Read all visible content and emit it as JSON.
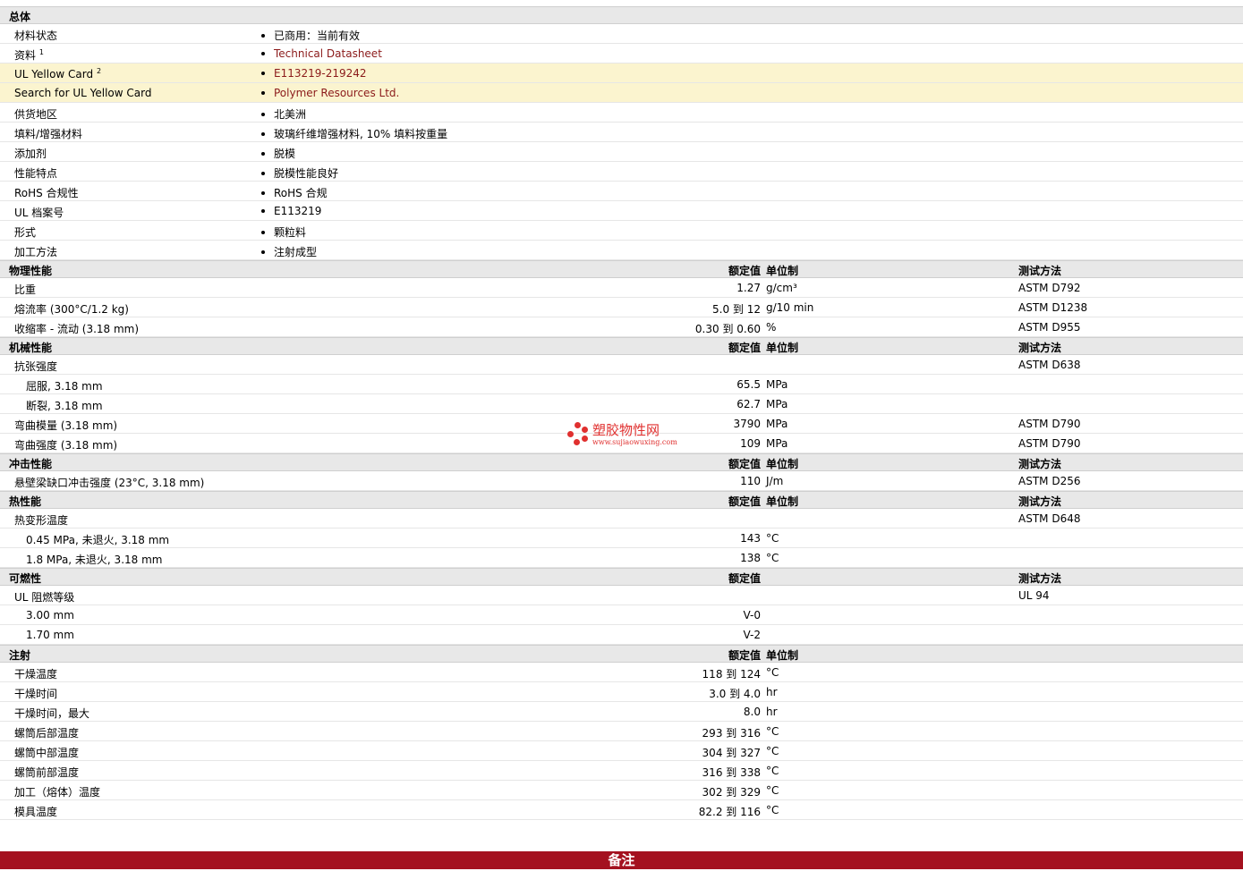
{
  "general": {
    "title": "总体",
    "rows": [
      {
        "label": "材料状态",
        "value": "已商用：当前有效"
      },
      {
        "label": "资料",
        "sup": "1",
        "value": "Technical Datasheet"
      },
      {
        "label": "UL Yellow Card",
        "sup": "2",
        "value": "E113219-219242"
      },
      {
        "label": "Search for UL Yellow Card",
        "value": "Polymer Resources Ltd."
      },
      {
        "label": "供货地区",
        "value": "北美洲"
      },
      {
        "label": "填料/增强材料",
        "value": "玻璃纤维增强材料, 10% 填料按重量"
      },
      {
        "label": "添加剂",
        "value": "脱模"
      },
      {
        "label": "性能特点",
        "value": "脱模性能良好"
      },
      {
        "label": "RoHS 合规性",
        "value": "RoHS 合规"
      },
      {
        "label": "UL 档案号",
        "value": "E113219"
      },
      {
        "label": "形式",
        "value": "颗粒料"
      },
      {
        "label": "加工方法",
        "value": "注射成型"
      }
    ]
  },
  "col_headers": {
    "nominal": "额定值",
    "unit": "单位制",
    "method": "测试方法"
  },
  "physical": {
    "title": "物理性能",
    "rows": [
      {
        "label": "比重",
        "value": "1.27",
        "unit": "g/cm³",
        "method": "ASTM D792"
      },
      {
        "label": "熔流率  (300°C/1.2 kg)",
        "value": "5.0 到  12",
        "unit": "g/10 min",
        "method": "ASTM D1238"
      },
      {
        "label": "收缩率  - 流动  (3.18 mm)",
        "value": "0.30 到  0.60",
        "unit": "%",
        "method": "ASTM D955"
      }
    ]
  },
  "mechanical": {
    "title": "机械性能",
    "rows": [
      {
        "label": "抗张强度",
        "value": "",
        "unit": "",
        "method": "ASTM D638"
      },
      {
        "label": "屈服, 3.18 mm",
        "value": "65.5",
        "unit": "MPa",
        "method": ""
      },
      {
        "label": "断裂, 3.18 mm",
        "value": "62.7",
        "unit": "MPa",
        "method": ""
      },
      {
        "label": "弯曲模量  (3.18 mm)",
        "value": "3790",
        "unit": "MPa",
        "method": "ASTM D790"
      },
      {
        "label": "弯曲强度  (3.18 mm)",
        "value": "109",
        "unit": "MPa",
        "method": "ASTM D790"
      }
    ]
  },
  "impact": {
    "title": "冲击性能",
    "rows": [
      {
        "label": "悬壁梁缺口冲击强度  (23°C, 3.18 mm)",
        "value": "110",
        "unit": "J/m",
        "method": "ASTM D256"
      }
    ]
  },
  "thermal": {
    "title": "热性能",
    "rows": [
      {
        "label": "热变形温度",
        "value": "",
        "unit": "",
        "method": "ASTM D648"
      },
      {
        "label": "0.45 MPa, 未退火, 3.18 mm",
        "value": "143",
        "unit": "°C",
        "method": ""
      },
      {
        "label": "1.8 MPa, 未退火, 3.18 mm",
        "value": "138",
        "unit": "°C",
        "method": ""
      }
    ]
  },
  "flammability": {
    "title": "可燃性",
    "rows": [
      {
        "label": "UL 阻燃等级",
        "value": "",
        "method": "UL 94"
      },
      {
        "label": "3.00 mm",
        "value": "V-0",
        "method": ""
      },
      {
        "label": "1.70 mm",
        "value": "V-2",
        "method": ""
      }
    ]
  },
  "injection": {
    "title": "注射",
    "rows": [
      {
        "label": "干燥温度",
        "value": "118 到  124",
        "unit": "°C"
      },
      {
        "label": "干燥时间",
        "value": "3.0 到  4.0",
        "unit": "hr"
      },
      {
        "label": "干燥时间，最大",
        "value": "8.0",
        "unit": "hr"
      },
      {
        "label": "螺筒后部温度",
        "value": "293 到  316",
        "unit": "°C"
      },
      {
        "label": "螺筒中部温度",
        "value": "304 到  327",
        "unit": "°C"
      },
      {
        "label": "螺筒前部温度",
        "value": "316 到  338",
        "unit": "°C"
      },
      {
        "label": "加工（熔体）温度",
        "value": "302 到  329",
        "unit": "°C"
      },
      {
        "label": "模具温度",
        "value": "82.2 到  116",
        "unit": "°C"
      }
    ]
  },
  "footer": {
    "title": "备注"
  },
  "watermark": {
    "name": "塑胶物性网",
    "url": "www.sujiaowuxing.com"
  }
}
